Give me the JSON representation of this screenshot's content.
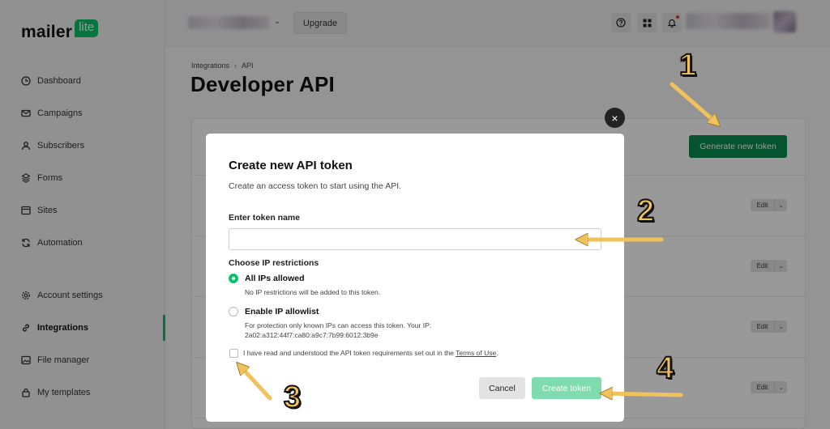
{
  "sidebar": {
    "logo_text": "mailer",
    "logo_badge": "lite",
    "items": [
      {
        "label": "Dashboard"
      },
      {
        "label": "Campaigns"
      },
      {
        "label": "Subscribers"
      },
      {
        "label": "Forms"
      },
      {
        "label": "Sites"
      },
      {
        "label": "Automation"
      },
      {
        "label": "Account settings"
      },
      {
        "label": "Integrations"
      },
      {
        "label": "File manager"
      },
      {
        "label": "My templates"
      }
    ],
    "active_item": "Integrations"
  },
  "topbar": {
    "upgrade_label": "Upgrade"
  },
  "page": {
    "breadcrumb": [
      "Integrations",
      "API"
    ],
    "title": "Developer API",
    "generate_label": "Generate new token",
    "edit_label": "Edit"
  },
  "modal": {
    "title": "Create new API token",
    "subtitle": "Create an access token to start using the API.",
    "token_label": "Enter token name",
    "token_value": "",
    "ip_label": "Choose IP restrictions",
    "options": [
      {
        "title": "All IPs allowed",
        "desc": "No IP restrictions will be added to this token.",
        "selected": true
      },
      {
        "title": "Enable IP allowlist",
        "desc": "For protection only known IPs can access this token. Your IP:",
        "ip": "2a02:a312:44f7:ca80:a9c7:7b99:6012:3b9e",
        "selected": false
      }
    ],
    "terms_text": "I have read and understood the API token requirements set out in the",
    "terms_link": "Terms of Use",
    "terms_end": ".",
    "cancel_label": "Cancel",
    "create_label": "Create token",
    "close_symbol": "×"
  },
  "annotations": [
    "1",
    "2",
    "3",
    "4"
  ],
  "colors": {
    "brand_green": "#09c269",
    "primary_button": "#0a8a4f",
    "disabled_button": "#7fdcae",
    "annotation_yellow": "#f1c15b"
  }
}
